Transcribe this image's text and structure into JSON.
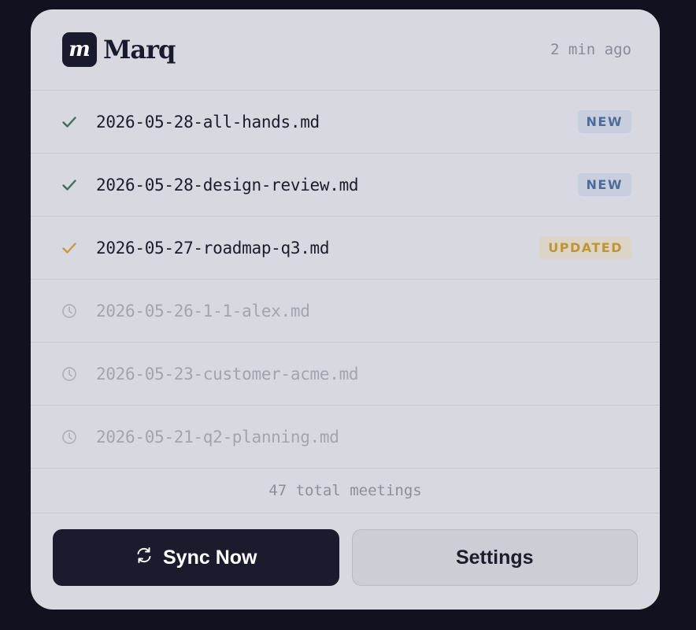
{
  "header": {
    "logo_letter": "m",
    "brand": "Marq",
    "timestamp": "2 min ago"
  },
  "files": [
    {
      "name": "2026-05-28-all-hands.md",
      "status": "done",
      "icon": "check-icon",
      "badge": "NEW",
      "badge_type": "new"
    },
    {
      "name": "2026-05-28-design-review.md",
      "status": "done",
      "icon": "check-icon",
      "badge": "NEW",
      "badge_type": "new"
    },
    {
      "name": "2026-05-27-roadmap-q3.md",
      "status": "updated",
      "icon": "check-icon",
      "badge": "UPDATED",
      "badge_type": "updated"
    },
    {
      "name": "2026-05-26-1-1-alex.md",
      "status": "pending",
      "icon": "clock-icon",
      "badge": "",
      "badge_type": ""
    },
    {
      "name": "2026-05-23-customer-acme.md",
      "status": "pending",
      "icon": "clock-icon",
      "badge": "",
      "badge_type": ""
    },
    {
      "name": "2026-05-21-q2-planning.md",
      "status": "pending",
      "icon": "clock-icon",
      "badge": "",
      "badge_type": ""
    }
  ],
  "footer": {
    "total": "47 total meetings"
  },
  "actions": {
    "sync_label": "Sync Now",
    "settings_label": "Settings"
  },
  "colors": {
    "check_green": "#3f6f5c",
    "check_amber": "#c69a3e",
    "clock_grey": "#b3b3bc"
  }
}
